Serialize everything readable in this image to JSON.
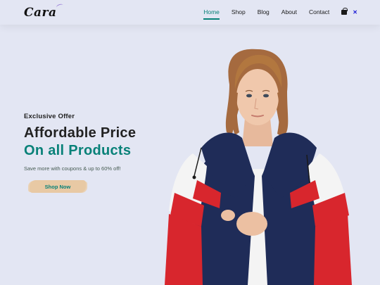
{
  "brand": {
    "logo": "Cara"
  },
  "nav": {
    "items": [
      {
        "label": "Home",
        "active": true
      },
      {
        "label": "Shop"
      },
      {
        "label": "Blog"
      },
      {
        "label": "About"
      },
      {
        "label": "Contact"
      }
    ],
    "icons": [
      "shopping-bag-icon",
      "close-icon"
    ]
  },
  "hero": {
    "kicker": "Exclusive Offer",
    "title_line1": "Affordable Price",
    "title_line2": "On all Products",
    "subtitle": "Save more with coupons & up to 60% off!",
    "button_label": "Shop Now"
  },
  "colors": {
    "background": "#e3e6f3",
    "accent": "#088178",
    "button_bg": "#e8c9a4",
    "jacket_navy": "#1f2c58",
    "jacket_red": "#d8262d"
  }
}
